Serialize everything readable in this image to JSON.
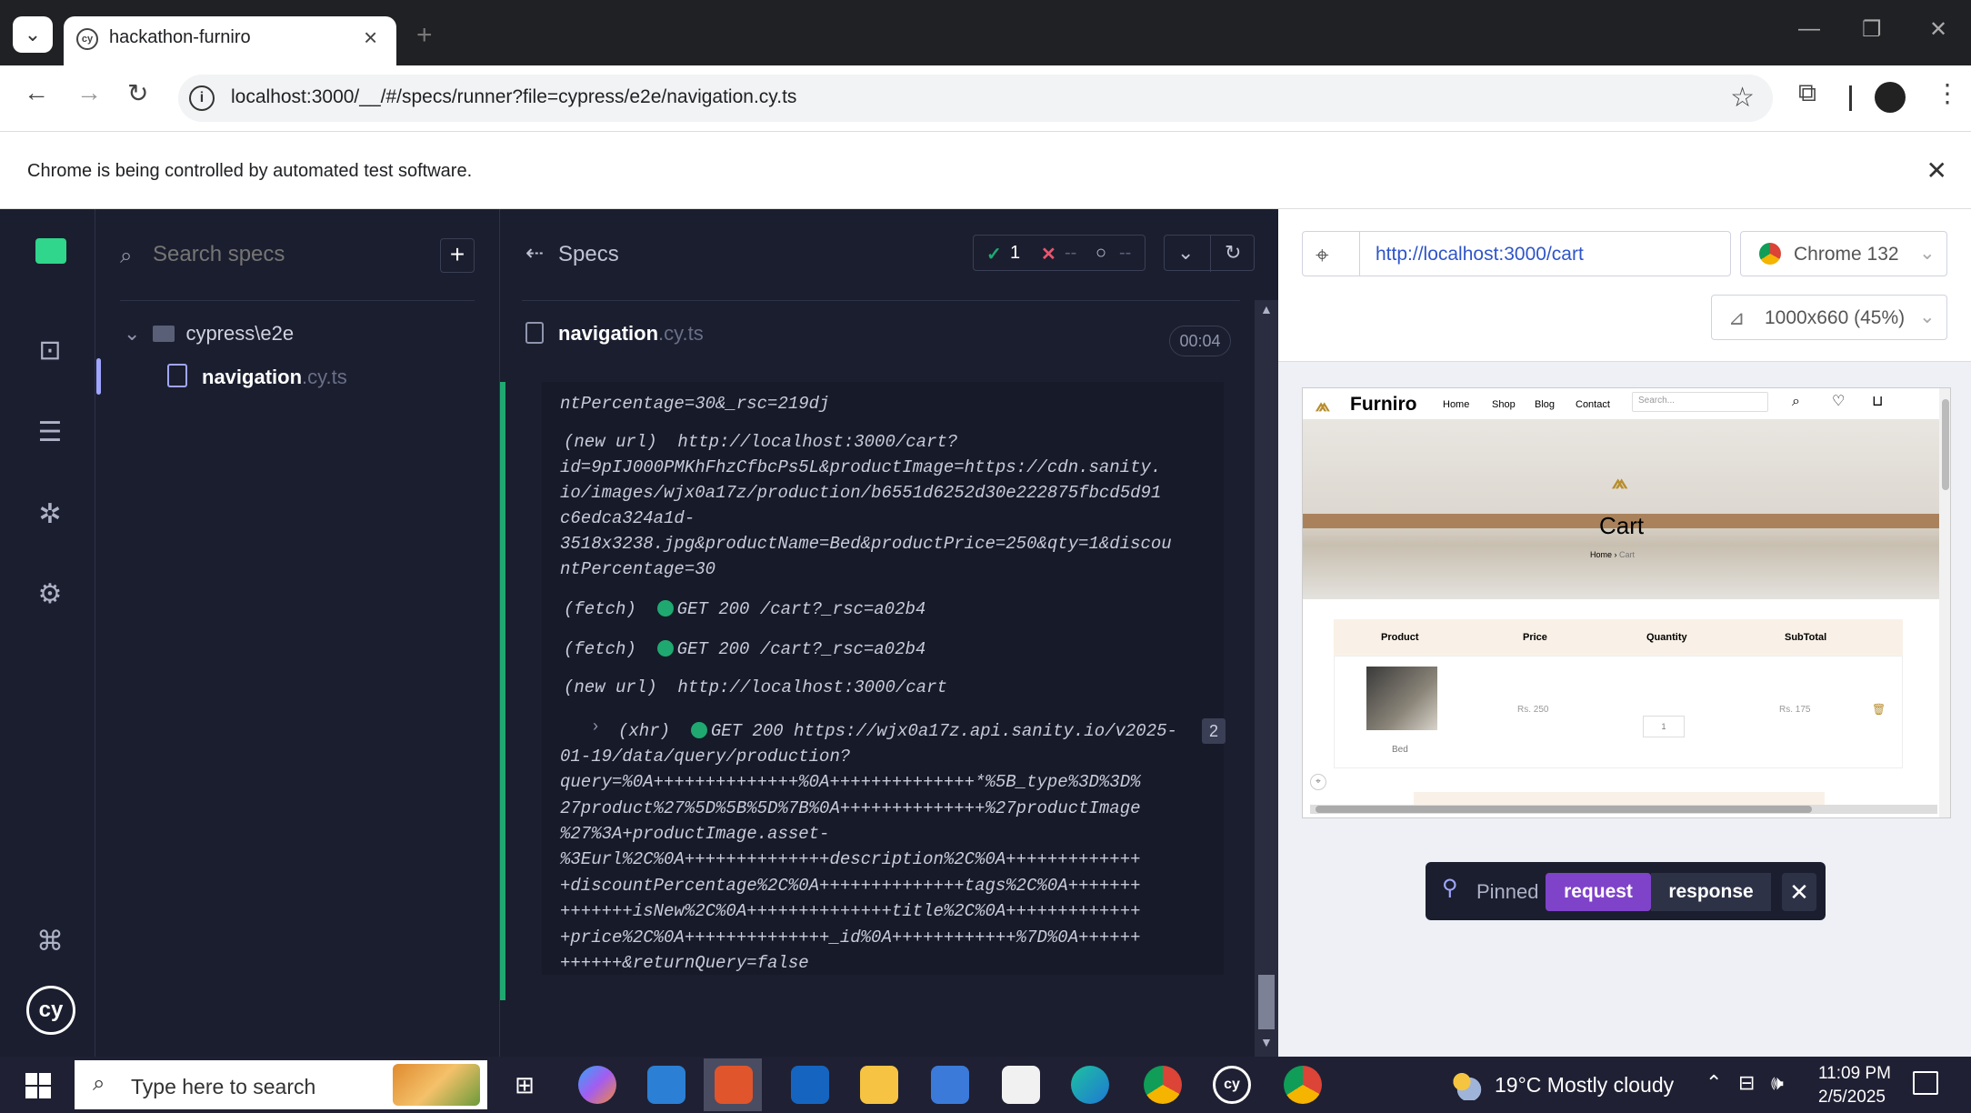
{
  "browser": {
    "tab_title": "hackathon-furniro",
    "url": "localhost:3000/__/#/specs/runner?file=cypress/e2e/navigation.cy.ts",
    "infobar_text": "Chrome is being controlled by automated test software."
  },
  "specs_panel": {
    "search_placeholder": "Search specs",
    "folder": "cypress\\e2e",
    "spec_name": "navigation",
    "spec_ext": ".cy.ts"
  },
  "reporter": {
    "header": "Specs",
    "passed": "1",
    "failed": "--",
    "pending": "--",
    "spec_name": "navigation",
    "spec_ext": ".cy.ts",
    "duration": "00:04",
    "log": [
      {
        "text": "ntPercentage=30&_rsc=219dj"
      },
      {
        "text": "(new url)  http://localhost:3000/cart?"
      },
      {
        "text": "id=9pIJ000PMKhFhzCfbcPs5L&productImage=https://cdn.sanity."
      },
      {
        "text": "io/images/wjx0a17z/production/b6551d6252d30e222875fbcd5d91"
      },
      {
        "text": "c6edca324a1d-"
      },
      {
        "text": "3518x3238.jpg&productName=Bed&productPrice=250&qty=1&discou"
      },
      {
        "text": "ntPercentage=30"
      },
      {
        "prefix": "(fetch)",
        "text": "GET 200 /cart?_rsc=a02b4"
      },
      {
        "prefix": "(fetch)",
        "text": "GET 200 /cart?_rsc=a02b4"
      },
      {
        "text": "(new url)  http://localhost:3000/cart"
      },
      {
        "prefix": "(xhr)",
        "text": "GET 200 https://wjx0a17z.api.sanity.io/v2025-"
      },
      {
        "text": "01-19/data/query/production?"
      },
      {
        "text": "query=%0A++++++++++++++%0A++++++++++++++*%5B_type%3D%3D%"
      },
      {
        "text": "27product%27%5D%5B%5D%7B%0A++++++++++++++%27productImage"
      },
      {
        "text": "%27%3A+productImage.asset-"
      },
      {
        "text": "%3Eurl%2C%0A++++++++++++++description%2C%0A+++++++++++++"
      },
      {
        "text": "+discountPercentage%2C%0A++++++++++++++tags%2C%0A+++++++"
      },
      {
        "text": "+++++++isNew%2C%0A++++++++++++++title%2C%0A+++++++++++++"
      },
      {
        "text": "+price%2C%0A++++++++++++++_id%0A++++++++++++%7D%0A++++++"
      },
      {
        "text": "++++++&returnQuery=false"
      }
    ],
    "xhr_count": "2"
  },
  "aut": {
    "url": "http://localhost:3000/cart",
    "browser": "Chrome 132",
    "viewport": "1000x660 (45%)",
    "site": {
      "brand": "Furniro",
      "nav": [
        "Home",
        "Shop",
        "Blog",
        "Contact"
      ],
      "search_placeholder": "Search...",
      "hero_title": "Cart",
      "breadcrumb_home": "Home",
      "breadcrumb_current": "Cart",
      "table_headers": [
        "Product",
        "Price",
        "Quantity",
        "SubTotal"
      ],
      "row": {
        "name": "Bed",
        "price": "Rs. 250",
        "qty": "1",
        "subtotal": "Rs. 175"
      }
    }
  },
  "pinned": {
    "label": "Pinned",
    "request": "request",
    "response": "response"
  },
  "taskbar": {
    "search_placeholder": "Type here to search",
    "weather": "19°C  Mostly cloudy",
    "time": "11:09 PM",
    "date": "2/5/2025"
  },
  "colors": {
    "accent_purple": "#7f43c9",
    "pass_green": "#1fa971",
    "fail_red": "#e45770",
    "brand_gold": "#b88e2f"
  }
}
